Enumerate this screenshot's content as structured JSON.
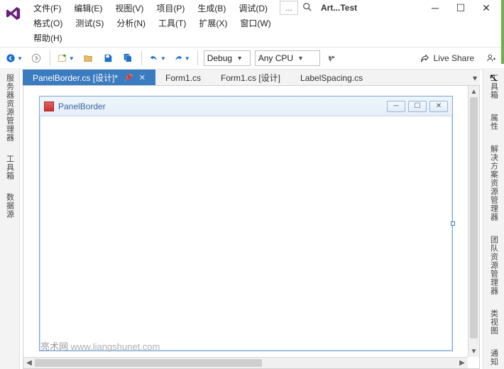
{
  "menu_row1": [
    "文件(F)",
    "编辑(E)",
    "视图(V)",
    "项目(P)",
    "生成(B)",
    "调试(D)"
  ],
  "menu_row2": [
    "格式(O)",
    "测试(S)",
    "分析(N)",
    "工具(T)",
    "扩展(X)",
    "窗口(W)"
  ],
  "menu_row3": [
    "帮助(H)"
  ],
  "search_ellipsis": "...",
  "project_label": "Art...Test",
  "toolbar": {
    "config": "Debug",
    "platform": "Any CPU",
    "live_share": "Live Share"
  },
  "tabs": [
    {
      "label": "PanelBorder.cs [设计]*",
      "active": true
    },
    {
      "label": "Form1.cs",
      "active": false
    },
    {
      "label": "Form1.cs [设计]",
      "active": false
    },
    {
      "label": "LabelSpacing.cs",
      "active": false
    }
  ],
  "left_tabs": [
    "服务器资源管理器",
    "工具箱",
    "数据源"
  ],
  "right_tabs": [
    "工具箱",
    "属性",
    "解决方案资源管理器",
    "团队资源管理器",
    "类视图",
    "通知"
  ],
  "form_title": "PanelBorder",
  "watermark_site": "亮术网",
  "watermark_url": "www.liangshunet.com"
}
